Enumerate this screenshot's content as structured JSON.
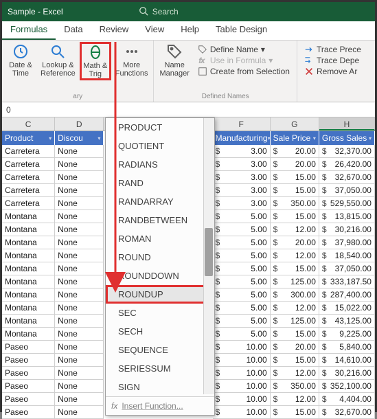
{
  "title": "Sample  -  Excel",
  "search_placeholder": "Search",
  "tabs": [
    "Formulas",
    "Data",
    "Review",
    "View",
    "Help",
    "Table Design"
  ],
  "active_tab": "Formulas",
  "ribbon": {
    "datetime": "Date &\nTime",
    "lookup": "Lookup &\nReference",
    "math": "Math &\nTrig",
    "more": "More\nFunctions",
    "name_mgr": "Name\nManager",
    "group_left": "ary",
    "group_names": "Defined Names",
    "define_name": "Define Name",
    "use_formula": "Use in Formula",
    "create_sel": "Create from Selection",
    "trace_prec": "Trace Prece",
    "trace_dep": "Trace Depe",
    "remove_arr": "Remove Ar"
  },
  "dropdown_items": [
    "PRODUCT",
    "QUOTIENT",
    "RADIANS",
    "RAND",
    "RANDARRAY",
    "RANDBETWEEN",
    "ROMAN",
    "ROUND",
    "ROUNDDOWN",
    "ROUNDUP",
    "SEC",
    "SECH",
    "SEQUENCE",
    "SERIESSUM",
    "SIGN"
  ],
  "dropdown_highlight": "ROUNDUP",
  "dropdown_footer": "Insert Function...",
  "formula_bar_value": "0",
  "columns": {
    "c": "C",
    "d": "D",
    "f": "F",
    "g": "G",
    "h": "H"
  },
  "headers": {
    "product": "Product",
    "discount": "Discou",
    "manuf": "Manufacturing",
    "sale": "Sale Price",
    "gross": "Gross Sales"
  },
  "rows": [
    {
      "p": "Carretera",
      "d": "None",
      "m": "3.00",
      "s": "20.00",
      "g": "32,370.00"
    },
    {
      "p": "Carretera",
      "d": "None",
      "m": "3.00",
      "s": "20.00",
      "g": "26,420.00"
    },
    {
      "p": "Carretera",
      "d": "None",
      "m": "3.00",
      "s": "15.00",
      "g": "32,670.00"
    },
    {
      "p": "Carretera",
      "d": "None",
      "m": "3.00",
      "s": "15.00",
      "g": "37,050.00"
    },
    {
      "p": "Carretera",
      "d": "None",
      "m": "3.00",
      "s": "350.00",
      "g": "529,550.00"
    },
    {
      "p": "Montana",
      "d": "None",
      "m": "5.00",
      "s": "15.00",
      "g": "13,815.00"
    },
    {
      "p": "Montana",
      "d": "None",
      "m": "5.00",
      "s": "12.00",
      "g": "30,216.00"
    },
    {
      "p": "Montana",
      "d": "None",
      "m": "5.00",
      "s": "20.00",
      "g": "37,980.00"
    },
    {
      "p": "Montana",
      "d": "None",
      "m": "5.00",
      "s": "12.00",
      "g": "18,540.00"
    },
    {
      "p": "Montana",
      "d": "None",
      "m": "5.00",
      "s": "15.00",
      "g": "37,050.00"
    },
    {
      "p": "Montana",
      "d": "None",
      "m": "5.00",
      "s": "125.00",
      "g": "333,187.50"
    },
    {
      "p": "Montana",
      "d": "None",
      "m": "5.00",
      "s": "300.00",
      "g": "287,400.00"
    },
    {
      "p": "Montana",
      "d": "None",
      "m": "5.00",
      "s": "12.00",
      "g": "15,022.00"
    },
    {
      "p": "Montana",
      "d": "None",
      "m": "5.00",
      "s": "125.00",
      "g": "43,125.00"
    },
    {
      "p": "Montana",
      "d": "None",
      "m": "5.00",
      "s": "15.00",
      "g": "9,225.00"
    },
    {
      "p": "Paseo",
      "d": "None",
      "m": "10.00",
      "s": "20.00",
      "g": "5,840.00"
    },
    {
      "p": "Paseo",
      "d": "None",
      "m": "10.00",
      "s": "15.00",
      "g": "14,610.00"
    },
    {
      "p": "Paseo",
      "d": "None",
      "m": "10.00",
      "s": "12.00",
      "g": "30,216.00"
    },
    {
      "p": "Paseo",
      "d": "None",
      "m": "10.00",
      "s": "350.00",
      "g": "352,100.00"
    },
    {
      "p": "Paseo",
      "d": "None",
      "m": "10.00",
      "s": "12.00",
      "g": "4,404.00"
    },
    {
      "p": "Paseo",
      "d": "None",
      "m": "10.00",
      "s": "15.00",
      "g": "32,670.00"
    }
  ]
}
